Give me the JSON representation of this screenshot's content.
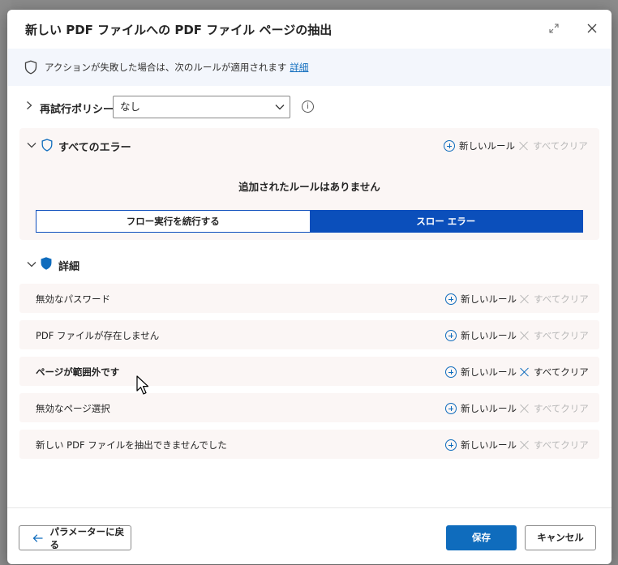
{
  "dialog": {
    "title": "新しい PDF ファイルへの PDF ファイル ページの抽出",
    "expand_icon": "expand-icon",
    "close_icon": "close-icon"
  },
  "info_bar": {
    "text": "アクションが失敗した場合は、次のルールが適用されます",
    "link": "詳細"
  },
  "retry_policy": {
    "label": "再試行ポリシー",
    "selected": "なし"
  },
  "all_errors": {
    "title": "すべてのエラー",
    "new_rule": "新しいルール",
    "clear_all": "すべてクリア",
    "no_rules": "追加されたルールはありません",
    "toggle": {
      "continue": "フロー実行を続行する",
      "throw": "スロー エラー",
      "active": "throw"
    }
  },
  "details": {
    "title": "詳細",
    "rows": [
      {
        "name": "無効なパスワード",
        "new_rule": "新しいルール",
        "clear_all": "すべてクリア",
        "clear_enabled": false
      },
      {
        "name": "PDF ファイルが存在しません",
        "new_rule": "新しいルール",
        "clear_all": "すべてクリア",
        "clear_enabled": false
      },
      {
        "name": "ページが範囲外です",
        "new_rule": "新しいルール",
        "clear_all": "すべてクリア",
        "clear_enabled": true
      },
      {
        "name": "無効なページ選択",
        "new_rule": "新しいルール",
        "clear_all": "すべてクリア",
        "clear_enabled": false
      },
      {
        "name": "新しい PDF ファイルを抽出できませんでした",
        "new_rule": "新しいルール",
        "clear_all": "すべてクリア",
        "clear_enabled": false
      }
    ]
  },
  "footer": {
    "back": "パラメーターに戻る",
    "save": "保存",
    "cancel": "キャンセル"
  },
  "colors": {
    "accent": "#0f6cbd",
    "toggle_active": "#0b4fbb",
    "section_bg": "#fbf6f5",
    "info_bg": "#f3f6fc"
  }
}
